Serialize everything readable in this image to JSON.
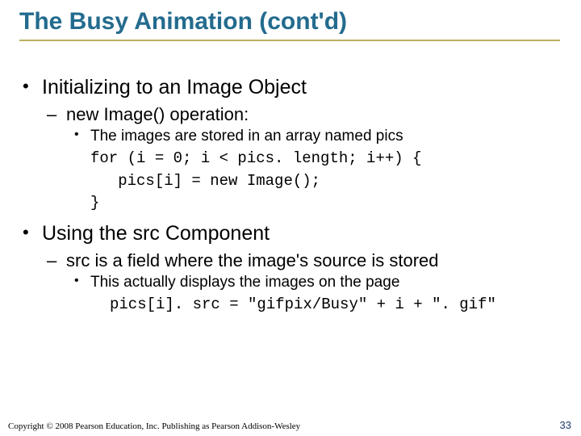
{
  "title": "The Busy Animation (cont'd)",
  "b1": {
    "i0": {
      "text": "Initializing to an Image Object",
      "sub": {
        "i0": {
          "text": "new Image() operation:",
          "sub3": {
            "i0": "The images are stored in an array named pics"
          },
          "code": "for (i = 0; i < pics. length; i++) {\n   pics[i] = new Image();\n}"
        }
      }
    },
    "i1": {
      "text": "Using the src Component",
      "sub": {
        "i0": {
          "text": "src is a field where the image's source is stored",
          "sub3": {
            "i0": "This actually displays the images on the page"
          },
          "code": "pics[i]. src = \"gifpix/Busy\" + i + \". gif\""
        }
      }
    }
  },
  "footer": "Copyright © 2008 Pearson Education, Inc. Publishing as Pearson Addison-Wesley",
  "pagenum": "33"
}
